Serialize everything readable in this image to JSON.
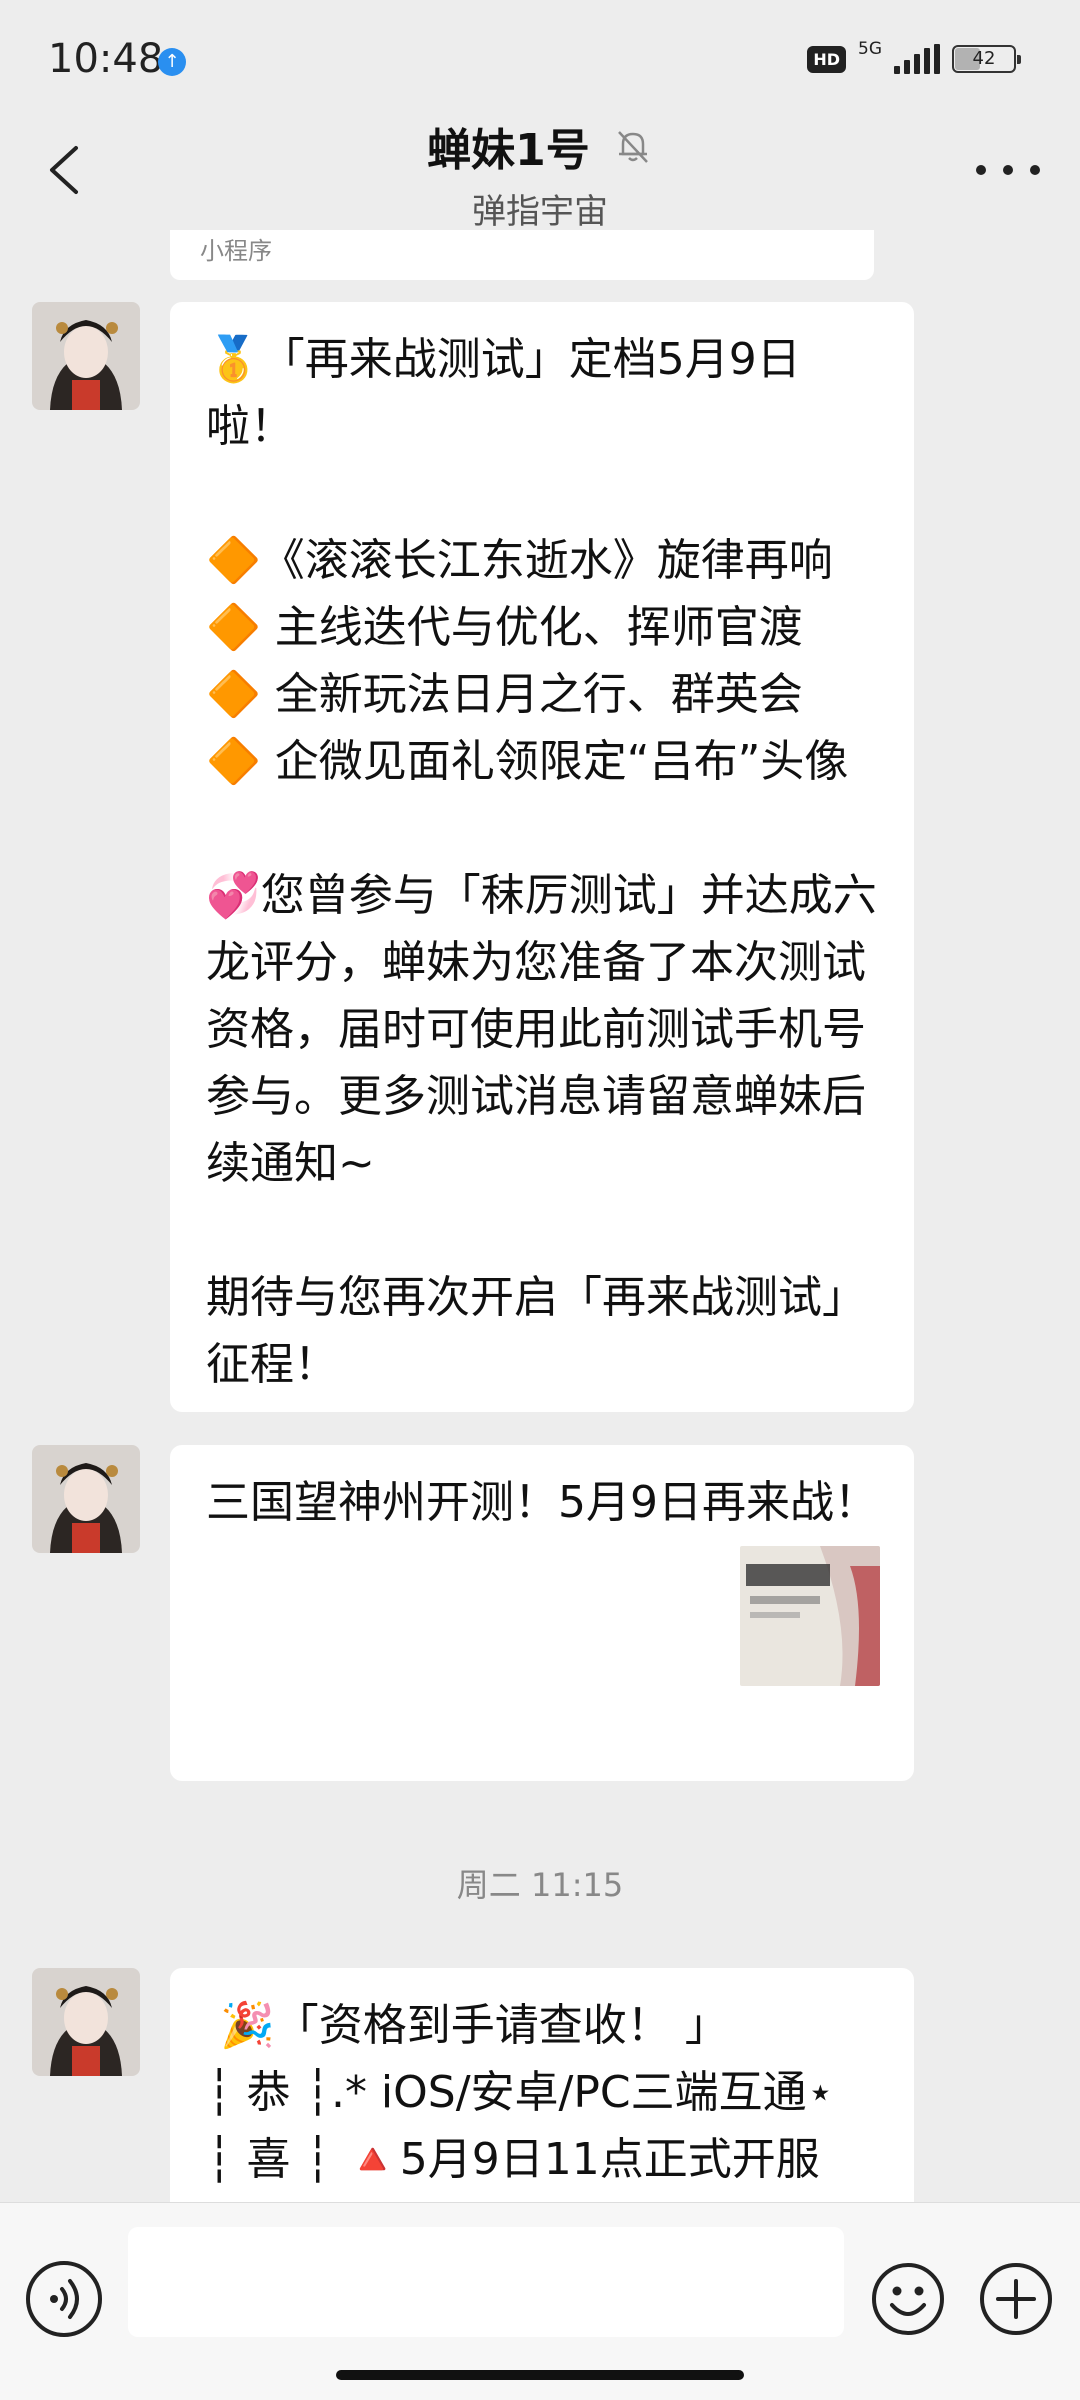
{
  "status_bar": {
    "time": "10:48",
    "hd": "HD",
    "network": "5G",
    "battery": "42",
    "battery_level": 0.42
  },
  "header": {
    "title": "蝉妹1号",
    "subtitle": "弹指宇宙",
    "back_icon": "chevron-left-icon",
    "mute_icon": "bell-off-icon",
    "more_icon": "more-dots-icon"
  },
  "previous_card": {
    "label": "小程序"
  },
  "messages": [
    {
      "text": "🥇「再来战测试」定档5月9日啦！\n\n🔶《滚滚长江东逝水》旋律再响\n🔶 主线迭代与优化、挥师官渡\n🔶 全新玩法日月之行、群英会\n🔶 企微见面礼领限定“吕布”头像\n\n💞您曾参与「秣厉测试」并达成六龙评分，蝉妹为您准备了本次测试资格，届时可使用此前测试手机号参与。更多测试消息请留意蝉妹后续通知~\n\n期待与您再次开启「再来战测试」征程！"
    },
    {
      "text": "三国望神州开测！5月9日再来战！"
    },
    {
      "text": " 🎉「资格到手请查收！ 」\n┆ 恭 ┆.* iOS/安卓/PC三端互通⋆\n┆ 喜 ┆ 🔺5月9日11点正式开服"
    }
  ],
  "timestamp": "周二 11:15",
  "input_bar": {
    "placeholder": "",
    "voice_icon": "voice-icon",
    "emoji_icon": "emoji-icon",
    "plus_icon": "plus-icon"
  }
}
